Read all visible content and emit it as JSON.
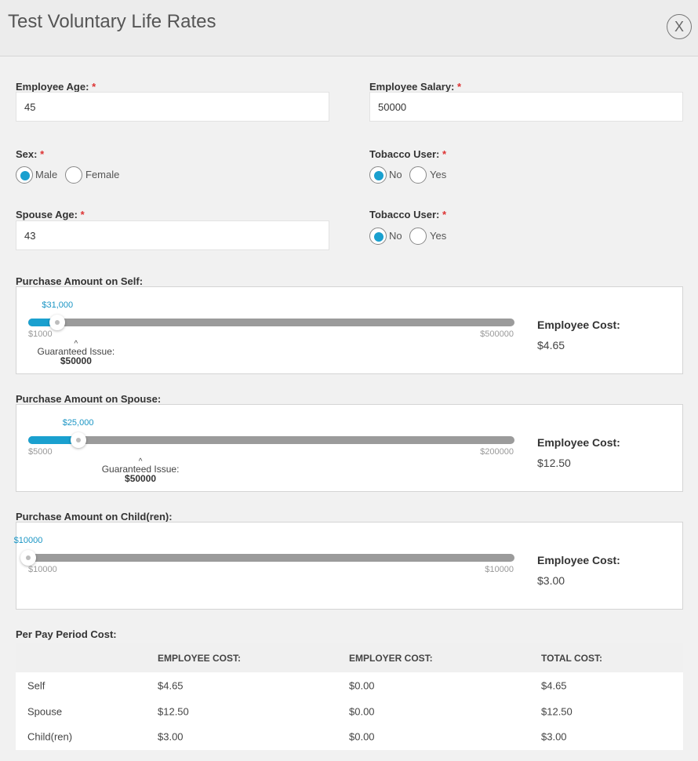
{
  "header": {
    "title": "Test Voluntary Life Rates",
    "close_label": "X"
  },
  "form": {
    "employee_age": {
      "label": "Employee Age:",
      "value": "45"
    },
    "employee_salary": {
      "label": "Employee Salary:",
      "value": "50000"
    },
    "sex": {
      "label": "Sex:",
      "options": [
        "Male",
        "Female"
      ],
      "selected": "Male"
    },
    "tobacco_user": {
      "label": "Tobacco User:",
      "options": [
        "No",
        "Yes"
      ],
      "selected": "No"
    },
    "spouse_age": {
      "label": "Spouse Age:",
      "value": "43"
    },
    "spouse_tobacco_user": {
      "label": "Tobacco User:",
      "options": [
        "No",
        "Yes"
      ],
      "selected": "No"
    },
    "required_mark": "*"
  },
  "self_purchase": {
    "label": "Purchase Amount on Self:",
    "value_label": "$31,000",
    "min_label": "$1000",
    "max_label": "$500000",
    "value": 31000,
    "min": 1000,
    "max": 500000,
    "guaranteed_issue_label": "Guaranteed Issue:",
    "guaranteed_issue_value": "$50000",
    "guaranteed_issue_amount": 50000,
    "cost_label": "Employee Cost:",
    "cost_value": "$4.65"
  },
  "spouse_purchase": {
    "label": "Purchase Amount on Spouse:",
    "value_label": "$25,000",
    "min_label": "$5000",
    "max_label": "$200000",
    "value": 25000,
    "min": 5000,
    "max": 200000,
    "guaranteed_issue_label": "Guaranteed Issue:",
    "guaranteed_issue_value": "$50000",
    "guaranteed_issue_amount": 50000,
    "cost_label": "Employee Cost:",
    "cost_value": "$12.50"
  },
  "child_purchase": {
    "label": "Purchase Amount on Child(ren):",
    "value_label": "$10000",
    "min_label": "$10000",
    "max_label": "$10000",
    "value": 10000,
    "min": 10000,
    "max": 10000,
    "cost_label": "Employee Cost:",
    "cost_value": "$3.00"
  },
  "per_pay_period": {
    "label": "Per Pay Period Cost:",
    "columns": [
      "",
      "EMPLOYEE COST:",
      "EMPLOYER COST:",
      "TOTAL COST:"
    ],
    "rows": [
      [
        "Self",
        "$4.65",
        "$0.00",
        "$4.65"
      ],
      [
        "Spouse",
        "$12.50",
        "$0.00",
        "$12.50"
      ],
      [
        "Child(ren)",
        "$3.00",
        "$0.00",
        "$3.00"
      ]
    ]
  },
  "colors": {
    "accent": "#1aa0cf",
    "required": "#dd3333",
    "track": "#9b9b9b"
  }
}
